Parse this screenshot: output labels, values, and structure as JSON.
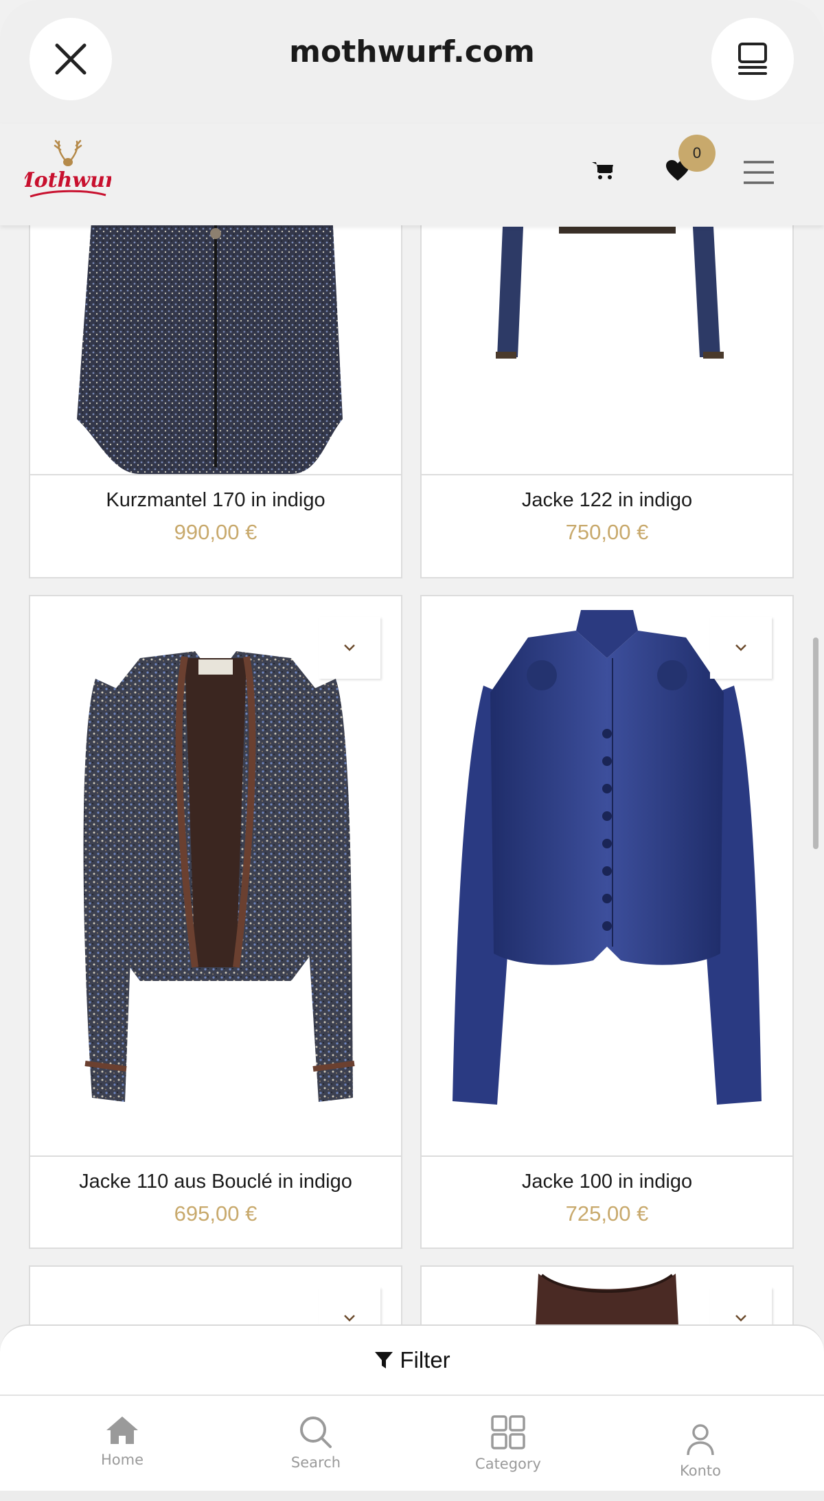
{
  "browser": {
    "url": "mothwurf.com",
    "close_icon": "close-icon",
    "reader_icon": "reader-mode-icon"
  },
  "header": {
    "logo_alt": "Mothwurf",
    "wishlist_count": "0",
    "colors": {
      "accent": "#c8a96c",
      "logo_red": "#c8102e"
    }
  },
  "products": [
    {
      "name": "Kurzmantel 170 in indigo",
      "price": "990,00 €"
    },
    {
      "name": "Jacke 122 in indigo",
      "price": "750,00 €"
    },
    {
      "name": "Jacke 110 aus Bouclé in indigo",
      "price": "695,00 €"
    },
    {
      "name": "Jacke 100 in indigo",
      "price": "725,00 €"
    }
  ],
  "filter": {
    "label": "Filter"
  },
  "bottom_nav": [
    {
      "label": "Home",
      "icon": "home-icon"
    },
    {
      "label": "Search",
      "icon": "search-icon"
    },
    {
      "label": "Category",
      "icon": "category-icon"
    },
    {
      "label": "Konto",
      "icon": "user-icon"
    }
  ]
}
